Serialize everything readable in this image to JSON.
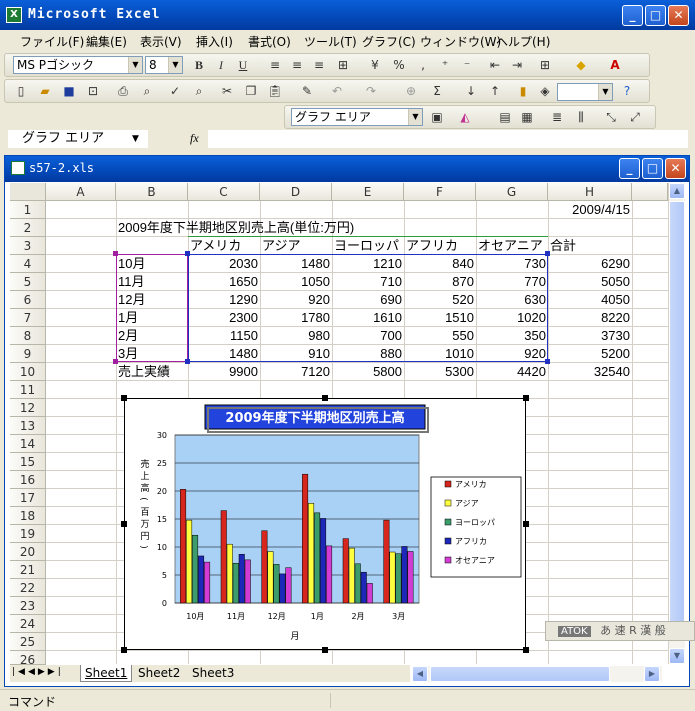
{
  "app": {
    "title": "Microsoft Excel",
    "icon_letter": "X"
  },
  "menu": [
    "ファイル(F)",
    "編集(E)",
    "表示(V)",
    "挿入(I)",
    "書式(O)",
    "ツール(T)",
    "グラフ(C)",
    "ウィンドウ(W)",
    "ヘルプ(H)"
  ],
  "toolbar": {
    "font_name": "MS Pゴシック",
    "font_size": "8",
    "bold": "B",
    "italic": "I",
    "underline": "U",
    "percent": "%",
    "chart_object": "グラフ エリア"
  },
  "formula_bar": {
    "name_box": "グラフ エリア",
    "fx": "fx",
    "formula": ""
  },
  "workbook": {
    "title": "s57-2.xls"
  },
  "columns": [
    "A",
    "B",
    "C",
    "D",
    "E",
    "F",
    "G",
    "H"
  ],
  "rows": [
    "1",
    "2",
    "3",
    "4",
    "5",
    "6",
    "7",
    "8",
    "9",
    "10",
    "11",
    "12",
    "13",
    "14",
    "15",
    "16",
    "17",
    "18",
    "19",
    "20",
    "21",
    "22",
    "23",
    "24",
    "25",
    "26"
  ],
  "cells": {
    "H1": "2009/4/15",
    "B2": "2009年度下半期地区別売上高(単位:万円)",
    "headers": [
      "アメリカ",
      "アジア",
      "ヨーロッパ",
      "アフリカ",
      "オセアニア",
      "合計"
    ],
    "table": [
      {
        "label": "10月",
        "values": [
          "2030",
          "1480",
          "1210",
          "840",
          "730",
          "6290"
        ]
      },
      {
        "label": "11月",
        "values": [
          "1650",
          "1050",
          "710",
          "870",
          "770",
          "5050"
        ]
      },
      {
        "label": "12月",
        "values": [
          "1290",
          "920",
          "690",
          "520",
          "630",
          "4050"
        ]
      },
      {
        "label": "1月",
        "values": [
          "2300",
          "1780",
          "1610",
          "1510",
          "1020",
          "8220"
        ]
      },
      {
        "label": "2月",
        "values": [
          "1150",
          "980",
          "700",
          "550",
          "350",
          "3730"
        ]
      },
      {
        "label": "3月",
        "values": [
          "1480",
          "910",
          "880",
          "1010",
          "920",
          "5200"
        ]
      }
    ],
    "total": {
      "label": "売上実績",
      "values": [
        "9900",
        "7120",
        "5800",
        "5300",
        "4420",
        "32540"
      ]
    }
  },
  "chart_data": {
    "type": "bar",
    "title": "2009年度下半期地区別売上高",
    "xlabel": "月",
    "ylabel": "売上高(百万円)",
    "ylim": [
      0,
      30
    ],
    "yticks": [
      "30",
      "25",
      "20",
      "15",
      "10",
      "5",
      "0"
    ],
    "categories": [
      "10月",
      "11月",
      "12月",
      "1月",
      "2月",
      "3月"
    ],
    "series": [
      {
        "name": "アメリカ",
        "color": "#D7261E",
        "values": [
          20.3,
          16.5,
          12.9,
          23.0,
          11.5,
          14.8
        ]
      },
      {
        "name": "アジア",
        "color": "#FFFF40",
        "values": [
          14.8,
          10.5,
          9.2,
          17.8,
          9.8,
          9.1
        ]
      },
      {
        "name": "ヨーロッパ",
        "color": "#3C9C6C",
        "values": [
          12.1,
          7.1,
          6.9,
          16.1,
          7.0,
          8.8
        ]
      },
      {
        "name": "アフリカ",
        "color": "#1E28B8",
        "values": [
          8.4,
          8.7,
          5.2,
          15.1,
          5.5,
          10.1
        ]
      },
      {
        "name": "オセアニア",
        "color": "#D23CD2",
        "values": [
          7.3,
          7.7,
          6.3,
          10.2,
          3.5,
          9.2
        ]
      }
    ],
    "legend": "right",
    "plot_bg": "#A9D1F5"
  },
  "sheets": [
    "Sheet1",
    "Sheet2",
    "Sheet3"
  ],
  "status": {
    "left": "コマンド"
  },
  "ime": {
    "label": "ATOK",
    "chars": "あ 速 R 漢 般"
  }
}
